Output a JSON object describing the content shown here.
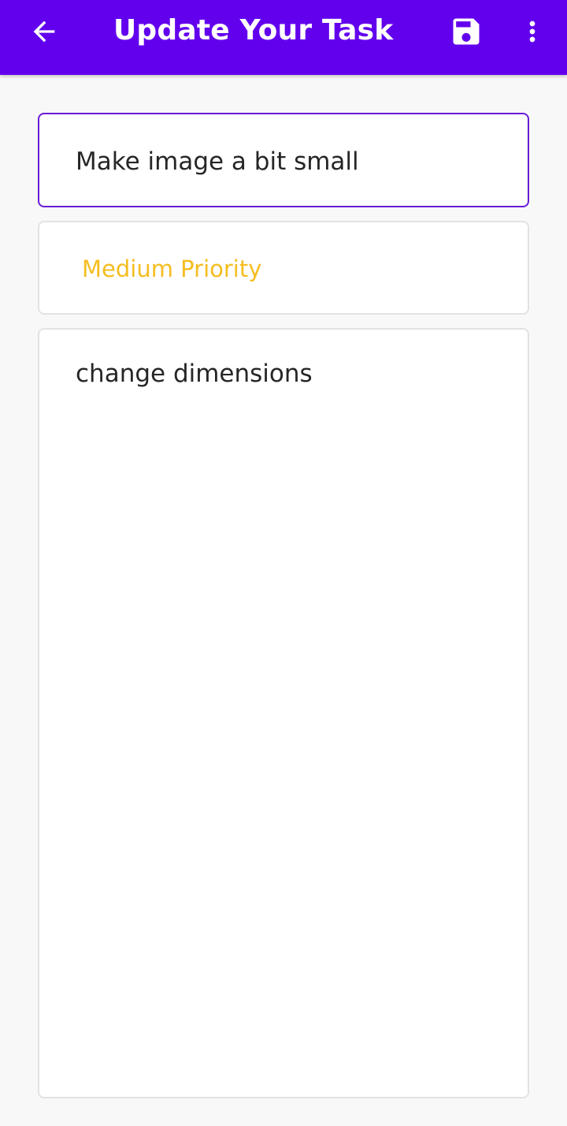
{
  "colors": {
    "app_bar": "#6200ee",
    "focused_border": "#6a1bd6",
    "priority_medium": "#f5bd1f",
    "background": "#f8f8f8"
  },
  "app_bar": {
    "title": "Update Your Task",
    "back_icon": "arrow-left-icon",
    "save_icon": "floppy-disk-icon",
    "more_icon": "more-vertical-icon"
  },
  "form": {
    "title_value": "Make image a bit small",
    "priority_selected": "Medium Priority",
    "description_value": "change dimensions"
  }
}
